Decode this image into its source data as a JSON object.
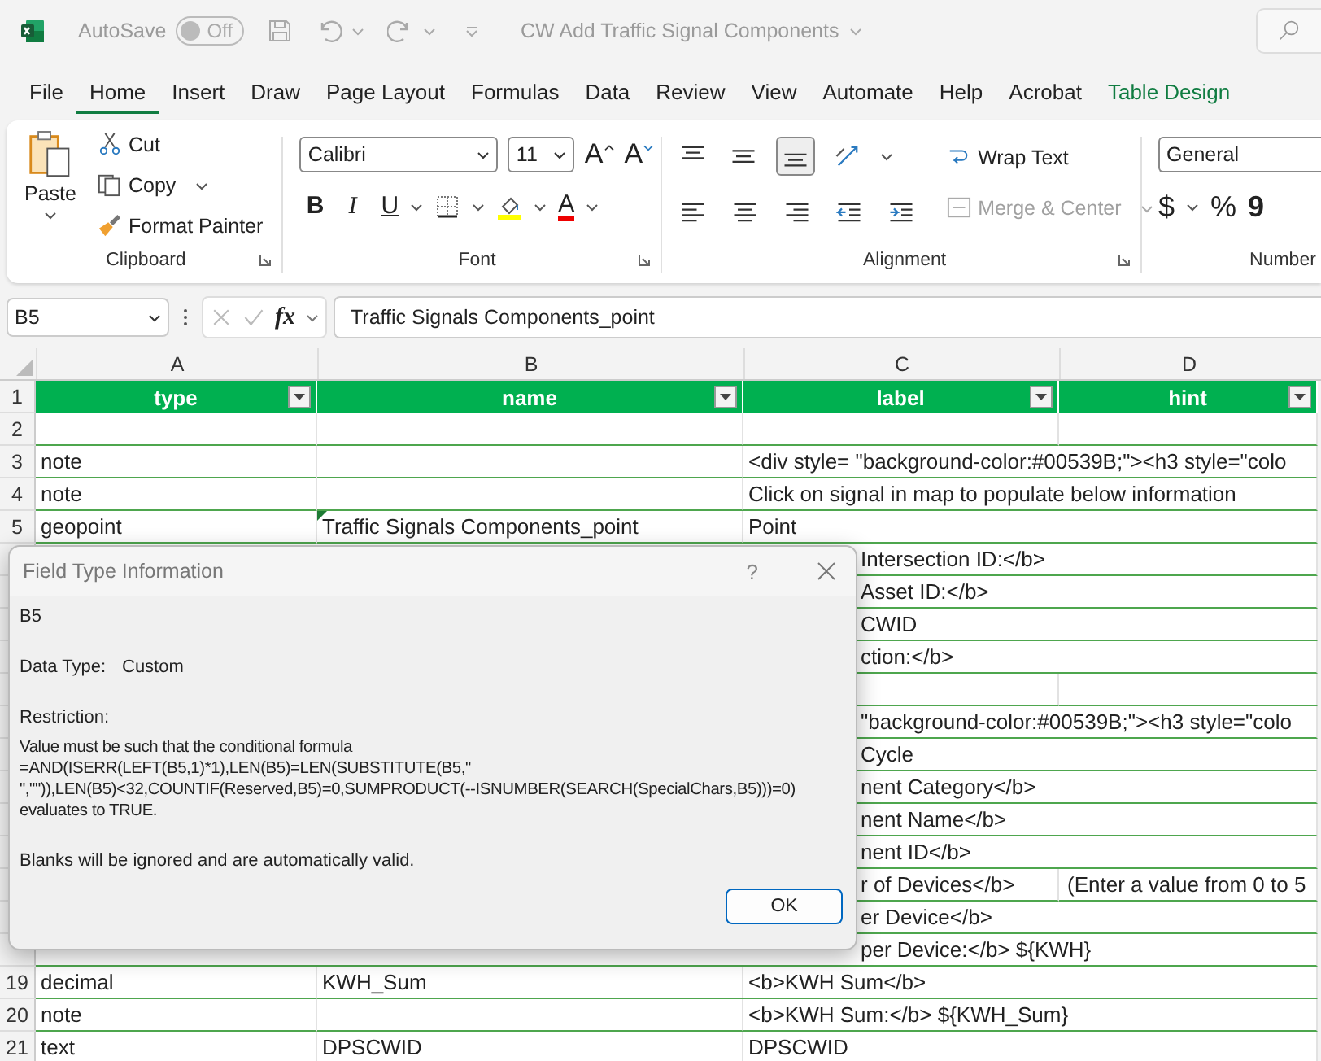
{
  "title_bar": {
    "autosave_label": "AutoSave",
    "autosave_on": false,
    "toggle_text": "Off",
    "document": "CW Add Traffic Signal Components"
  },
  "menu_tabs": [
    {
      "label": "File",
      "selected": false,
      "kind": "standard"
    },
    {
      "label": "Home",
      "selected": true,
      "kind": "standard"
    },
    {
      "label": "Insert",
      "selected": false,
      "kind": "standard"
    },
    {
      "label": "Draw",
      "selected": false,
      "kind": "standard"
    },
    {
      "label": "Page Layout",
      "selected": false,
      "kind": "standard"
    },
    {
      "label": "Formulas",
      "selected": false,
      "kind": "standard"
    },
    {
      "label": "Data",
      "selected": false,
      "kind": "standard"
    },
    {
      "label": "Review",
      "selected": false,
      "kind": "standard"
    },
    {
      "label": "View",
      "selected": false,
      "kind": "standard"
    },
    {
      "label": "Automate",
      "selected": false,
      "kind": "standard"
    },
    {
      "label": "Help",
      "selected": false,
      "kind": "standard"
    },
    {
      "label": "Acrobat",
      "selected": false,
      "kind": "standard"
    },
    {
      "label": "Table Design",
      "selected": false,
      "kind": "contextual"
    }
  ],
  "ribbon": {
    "clipboard": {
      "paste": "Paste",
      "cut": "Cut",
      "copy": "Copy",
      "format_painter": "Format Painter",
      "group": "Clipboard"
    },
    "font": {
      "family": "Calibri",
      "size": "11",
      "grow": "A",
      "shrink": "A",
      "bold": "B",
      "italic": "I",
      "underline": "U",
      "font_color": "A",
      "group": "Font"
    },
    "alignment": {
      "wrap_text": "Wrap Text",
      "merge": "Merge & Center",
      "merge_disabled": true,
      "group": "Alignment"
    },
    "number": {
      "format": "General",
      "currency": "$",
      "percent": "%",
      "comma": "9",
      "group": "Number"
    }
  },
  "formula_bar": {
    "name_box": "B5",
    "fx": "fx",
    "formula": "Traffic Signals Components_point"
  },
  "columns": [
    "A",
    "B",
    "C",
    "D"
  ],
  "header_row": {
    "num": "1",
    "cells": [
      "type",
      "name",
      "label",
      "hint"
    ]
  },
  "rows": [
    {
      "kind": "normal",
      "num": "2",
      "cells": [
        "",
        "",
        "",
        ""
      ]
    },
    {
      "kind": "normal",
      "num": "3",
      "cells": [
        "note",
        "",
        "<div style= \"background-color:#00539B;\"><h3 style=\"colo",
        ""
      ]
    },
    {
      "kind": "normal",
      "num": "4",
      "cells": [
        "note",
        "",
        "Click on signal in map to populate below information",
        ""
      ]
    },
    {
      "kind": "normal",
      "num": "5",
      "cells": [
        "geopoint",
        "Traffic Signals Components_point",
        "Point",
        ""
      ]
    },
    {
      "kind": "covered",
      "cells": [
        "",
        "",
        "Intersection ID:</b>",
        ""
      ]
    },
    {
      "kind": "covered",
      "cells": [
        "",
        "",
        "Asset ID:</b>",
        ""
      ]
    },
    {
      "kind": "covered",
      "cells": [
        "",
        "",
        "CWID",
        ""
      ]
    },
    {
      "kind": "covered",
      "cells": [
        "",
        "",
        "ction:</b>",
        ""
      ]
    },
    {
      "kind": "covered",
      "cells": [
        "",
        "",
        "",
        ""
      ]
    },
    {
      "kind": "covered",
      "cells": [
        "",
        "",
        "\"background-color:#00539B;\"><h3 style=\"colo",
        ""
      ]
    },
    {
      "kind": "covered",
      "cells": [
        "",
        "",
        "Cycle",
        ""
      ]
    },
    {
      "kind": "covered",
      "cells": [
        "",
        "",
        "nent Category</b>",
        ""
      ]
    },
    {
      "kind": "covered",
      "cells": [
        "",
        "",
        "nent Name</b>",
        ""
      ]
    },
    {
      "kind": "covered",
      "cells": [
        "",
        "",
        "nent ID</b>",
        ""
      ]
    },
    {
      "kind": "covered",
      "cells": [
        "",
        "",
        "r of Devices</b>",
        "(Enter a value from 0 to 5"
      ]
    },
    {
      "kind": "covered",
      "cells": [
        "",
        "",
        "er Device</b>",
        ""
      ]
    },
    {
      "kind": "covered",
      "cells": [
        "",
        "",
        "per Device:</b> ${KWH}",
        ""
      ]
    },
    {
      "kind": "normal",
      "num": "19",
      "cells": [
        "decimal",
        "KWH_Sum",
        "<b>KWH Sum</b>",
        ""
      ]
    },
    {
      "kind": "normal",
      "num": "20",
      "cells": [
        "note",
        "",
        "<b>KWH Sum:</b> ${KWH_Sum}",
        ""
      ]
    },
    {
      "kind": "normal",
      "num": "21",
      "cells": [
        "text",
        "DPSCWID",
        "DPSCWID",
        ""
      ]
    }
  ],
  "dialog": {
    "title": "Field Type Information",
    "help": "?",
    "cell_ref": "B5",
    "data_type_label": "Data Type:",
    "data_type": "Custom",
    "restriction_label": "Restriction:",
    "restriction": "Value must be such that the conditional formula\n=AND(ISERR(LEFT(B5,1)*1),LEN(B5)=LEN(SUBSTITUTE(B5,\"\n\",\"\")),LEN(B5)<32,COUNTIF(Reserved,B5)=0,SUMPRODUCT(--ISNUMBER(SEARCH(SpecialChars,B5)))=0)\nevaluates to TRUE.",
    "note": "Blanks will be ignored and are automatically valid.",
    "ok": "OK"
  }
}
